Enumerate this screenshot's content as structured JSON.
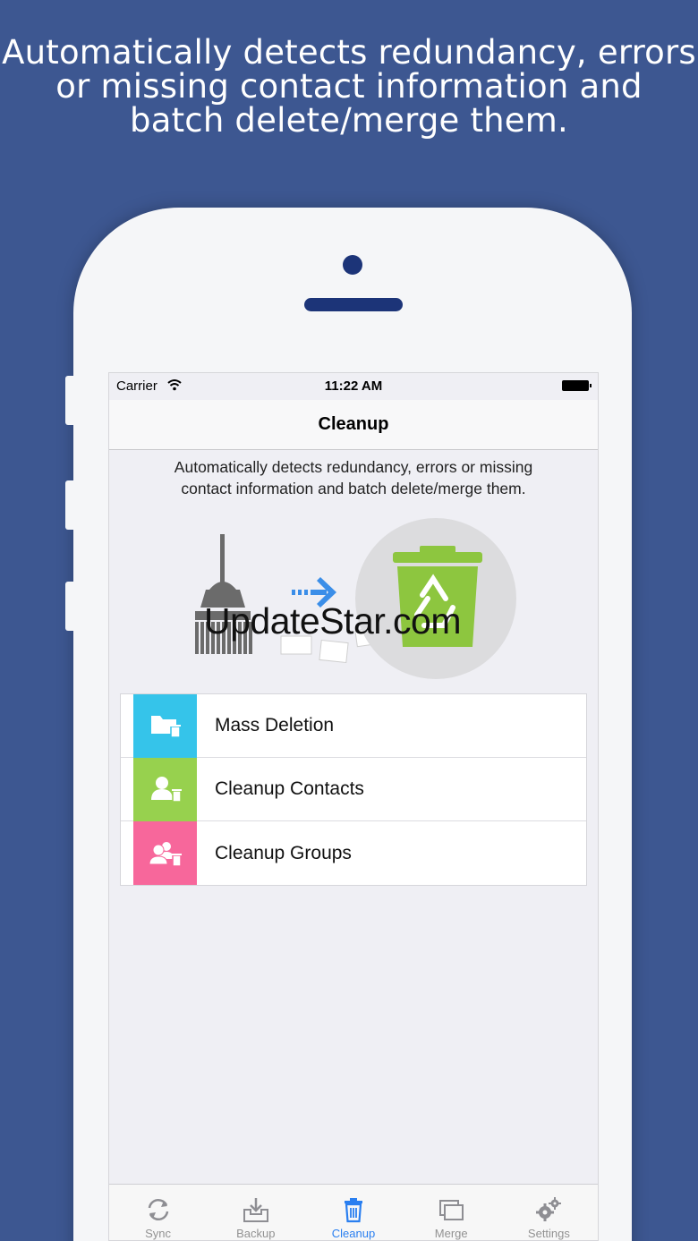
{
  "headline": {
    "line1": "Automatically detects redundancy, errors",
    "line2": "or missing contact information and",
    "line3": "batch delete/merge them."
  },
  "status_bar": {
    "carrier": "Carrier",
    "time": "11:22 AM"
  },
  "nav": {
    "title": "Cleanup"
  },
  "description": {
    "line1": "Automatically detects redundancy, errors or missing",
    "line2": "contact information and batch delete/merge them."
  },
  "watermark": "UpdateStar.com",
  "menu": {
    "items": [
      {
        "label": "Mass Deletion",
        "color": "#35c4ea",
        "icon": "folder-delete-icon"
      },
      {
        "label": "Cleanup Contacts",
        "color": "#97d14e",
        "icon": "contact-delete-icon"
      },
      {
        "label": "Cleanup Groups",
        "color": "#f7679b",
        "icon": "group-delete-icon"
      }
    ]
  },
  "tabbar": {
    "tabs": [
      {
        "label": "Sync",
        "icon": "sync-icon",
        "active": false
      },
      {
        "label": "Backup",
        "icon": "backup-icon",
        "active": false
      },
      {
        "label": "Cleanup",
        "icon": "trash-icon",
        "active": true
      },
      {
        "label": "Merge",
        "icon": "merge-icon",
        "active": false
      },
      {
        "label": "Settings",
        "icon": "gear-icon",
        "active": false
      }
    ]
  },
  "colors": {
    "background": "#3d5791",
    "accent": "#2a7ff0",
    "bin_green": "#8dc63f"
  }
}
